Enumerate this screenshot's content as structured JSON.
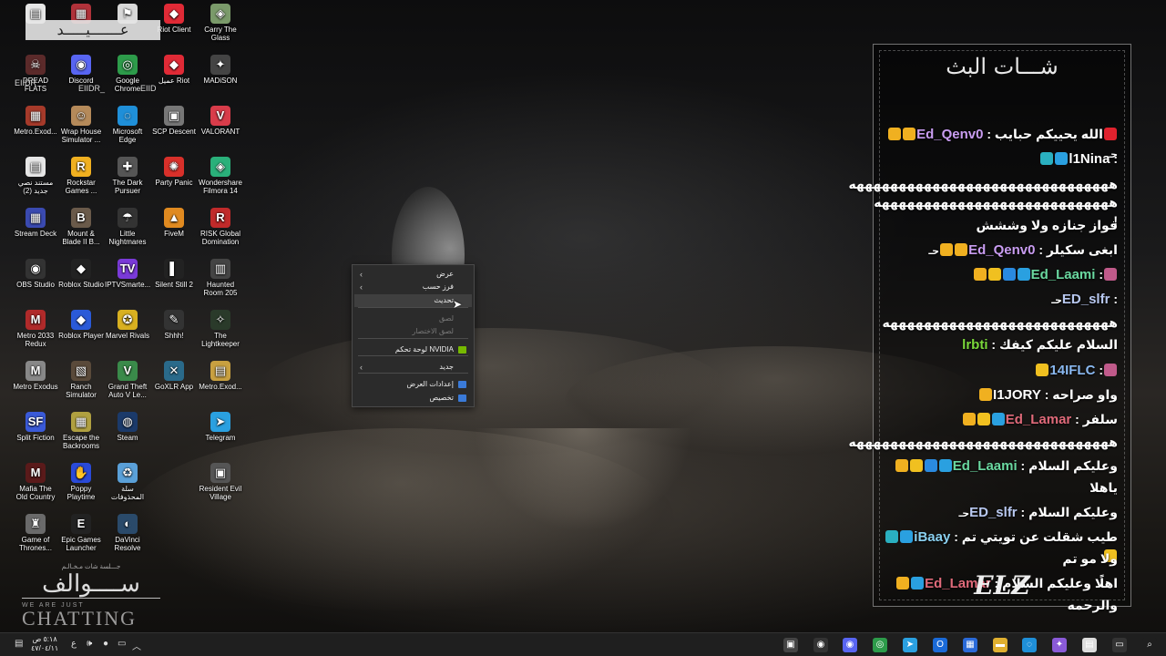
{
  "desktop": {
    "icons": [
      {
        "label": "",
        "glyph": "▤",
        "color": "#e6e6e6"
      },
      {
        "label": "",
        "glyph": "▦",
        "color": "#b0323a"
      },
      {
        "label": "",
        "glyph": "⚑",
        "color": "#d8d8d8"
      },
      {
        "label": "Riot Client",
        "glyph": "◆",
        "color": "#e02a36"
      },
      {
        "label": "Carry The Glass",
        "glyph": "◈",
        "color": "#7a9a6a"
      },
      {
        "label": "DREAD FLATS",
        "glyph": "☠",
        "color": "#5b2a2a"
      },
      {
        "label": "Discord",
        "glyph": "◉",
        "color": "#5865f2"
      },
      {
        "label": "Google Chrome",
        "glyph": "◎",
        "color": "#2d9b4a"
      },
      {
        "label": "عميل Riot",
        "glyph": "◆",
        "color": "#e02a36"
      },
      {
        "label": "MADiSON",
        "glyph": "✦",
        "color": "#444"
      },
      {
        "label": "Metro.Exod...",
        "glyph": "▦",
        "color": "#a63a2a"
      },
      {
        "label": "Wrap House Simulator ...",
        "glyph": "☺",
        "color": "#b58a5a"
      },
      {
        "label": "Microsoft Edge",
        "glyph": "◌",
        "color": "#1f8fd8"
      },
      {
        "label": "SCP Descent",
        "glyph": "▣",
        "color": "#777"
      },
      {
        "label": "VALORANT",
        "glyph": "V",
        "color": "#d83c4a"
      },
      {
        "label": "مستند نصي جديد (2)",
        "glyph": "▤",
        "color": "#e6e6e6"
      },
      {
        "label": "Rockstar Games ...",
        "glyph": "R",
        "color": "#f0b020"
      },
      {
        "label": "The Dark Pursuer",
        "glyph": "✚",
        "color": "#555"
      },
      {
        "label": "Party Panic",
        "glyph": "✺",
        "color": "#d8302a"
      },
      {
        "label": "Wondershare Filmora 14",
        "glyph": "◈",
        "color": "#2ab07a"
      },
      {
        "label": "Stream Deck",
        "glyph": "▦",
        "color": "#3a4ab0"
      },
      {
        "label": "Mount & Blade II B...",
        "glyph": "B",
        "color": "#6a5a4a"
      },
      {
        "label": "Little Nightmares",
        "glyph": "☂",
        "color": "#333"
      },
      {
        "label": "FiveM",
        "glyph": "▲",
        "color": "#e08a20"
      },
      {
        "label": "RISK Global Domination",
        "glyph": "R",
        "color": "#c02a2a"
      },
      {
        "label": "OBS Studio",
        "glyph": "◉",
        "color": "#333"
      },
      {
        "label": "Roblox Studio",
        "glyph": "◆",
        "color": "#222"
      },
      {
        "label": "IPTVSmarte...",
        "glyph": "TV",
        "color": "#7a3ad8"
      },
      {
        "label": "Silent Still 2",
        "glyph": "▌",
        "color": "#222"
      },
      {
        "label": "Haunted Room 205",
        "glyph": "▥",
        "color": "#444"
      },
      {
        "label": "Metro 2033 Redux",
        "glyph": "M",
        "color": "#b02a2a"
      },
      {
        "label": "Roblox Player",
        "glyph": "◆",
        "color": "#2a5ad8"
      },
      {
        "label": "Marvel Rivals",
        "glyph": "✪",
        "color": "#d8b020"
      },
      {
        "label": "Shhh!",
        "glyph": "✎",
        "color": "#333"
      },
      {
        "label": "The Lightkeeper",
        "glyph": "✧",
        "color": "#2a3a2a"
      },
      {
        "label": "Metro Exodus",
        "glyph": "M",
        "color": "#888"
      },
      {
        "label": "Ranch Simulator",
        "glyph": "▧",
        "color": "#5a4a3a"
      },
      {
        "label": "Grand Theft Auto V Le...",
        "glyph": "V",
        "color": "#3a8a4a"
      },
      {
        "label": "GoXLR App",
        "glyph": "✕",
        "color": "#2a6a8a"
      },
      {
        "label": "Metro.Exod...",
        "glyph": "▤",
        "color": "#c8a040"
      },
      {
        "label": "Split Fiction",
        "glyph": "SF",
        "color": "#3a5ad8"
      },
      {
        "label": "Escape the Backrooms",
        "glyph": "▦",
        "color": "#b0a040"
      },
      {
        "label": "Steam",
        "glyph": "◍",
        "color": "#1b3a6a"
      },
      {
        "label": "",
        "glyph": "",
        "color": "transparent"
      },
      {
        "label": "Telegram",
        "glyph": "➤",
        "color": "#2aa0e0"
      },
      {
        "label": "Mafia The Old Country",
        "glyph": "M",
        "color": "#5a1a1a"
      },
      {
        "label": "Poppy Playtime",
        "glyph": "✋",
        "color": "#2a4ad8"
      },
      {
        "label": "سلة المحذوفات",
        "glyph": "♻",
        "color": "#5aa0d8"
      },
      {
        "label": "",
        "glyph": "",
        "color": "transparent"
      },
      {
        "label": "Resident Evil Village",
        "glyph": "▣",
        "color": "#555"
      },
      {
        "label": "Game of Thrones...",
        "glyph": "♜",
        "color": "#6a6a6a"
      },
      {
        "label": "Epic Games Launcher",
        "glyph": "E",
        "color": "#222"
      },
      {
        "label": "DaVinci Resolve",
        "glyph": "◐",
        "color": "#2a4a6a"
      }
    ],
    "name_overlay": "عـــــــيـــــد",
    "discord_overlay": [
      "EIIDR",
      "EIIDR_",
      "EIID"
    ],
    "brand": {
      "sub": "جـــلسة شات مـخـالـم",
      "arabic": "ســــوالف",
      "small": "WE ARE JUST",
      "big": "CHATTING"
    }
  },
  "context_menu": {
    "items": [
      {
        "label": "عرض",
        "arrow": true,
        "state": "normal"
      },
      {
        "label": "فرز حسب",
        "arrow": true,
        "state": "normal"
      },
      {
        "label": "تحديث",
        "arrow": false,
        "state": "hover"
      },
      {
        "label": "لصق",
        "arrow": false,
        "state": "disabled"
      },
      {
        "label": "لصق الاختصار",
        "arrow": false,
        "state": "disabled"
      },
      {
        "label": "لوحة تحكم NVIDIA",
        "arrow": false,
        "state": "normal",
        "icon_color": "#76b900"
      },
      {
        "label": "جديد",
        "arrow": true,
        "state": "normal"
      },
      {
        "label": "إعدادات العرض",
        "arrow": false,
        "state": "normal",
        "icon_color": "#3a7ad8"
      },
      {
        "label": "تخصيص",
        "arrow": false,
        "state": "normal",
        "icon_color": "#3a7ad8"
      }
    ]
  },
  "chat": {
    "title": "شـــات البث",
    "logo": "ELZ",
    "messages": [
      {
        "badges": [
          "#e0222e"
        ],
        "text": "الله يحييكم حبايب : ",
        "user": "Ed_Qenv0",
        "user_color": "#c89cf0",
        "extra_badges": [
          "#f0b020",
          "#f0b020"
        ],
        "tail": "حـ"
      },
      {
        "badges": [],
        "text": ": ",
        "user": "l1Nina",
        "user_color": "#ffffff",
        "extra_badges": [
          "#2aa0e0",
          "#2ab0c0"
        ],
        "tail": ""
      },
      {
        "badges": [],
        "text": "هههههههههههههههههههههههههههههههه",
        "user": "",
        "user_color": "#fff",
        "extra_badges": [],
        "tail": ""
      },
      {
        "badges": [],
        "text": "ههههههههههههههههههههههههههههه !",
        "user": "",
        "user_color": "#fff",
        "extra_badges": [],
        "tail": ""
      },
      {
        "badges": [],
        "text": "فواز جنازه ولا وششش",
        "user": "",
        "user_color": "#fff",
        "extra_badges": [],
        "tail": ""
      },
      {
        "badges": [],
        "text": "ابغى سكيلر : ",
        "user": "Ed_Qenv0",
        "user_color": "#c89cf0",
        "extra_badges": [
          "#f0b020",
          "#f0b020"
        ],
        "tail": "حـ"
      },
      {
        "badges": [
          "#c05a8a"
        ],
        "text": ": ",
        "user": "Ed_Laami",
        "user_color": "#6ad8a0",
        "extra_badges": [
          "#2aa0e0",
          "#2a8ae0",
          "#f0c020",
          "#f0b020"
        ],
        "tail": ""
      },
      {
        "badges": [],
        "text": ": ",
        "user": "ED_slfr",
        "user_color": "#b8c8f0",
        "extra_badges": [],
        "tail": "حـ"
      },
      {
        "badges": [],
        "text": "هههههههههههههههههههههههههههه",
        "user": "",
        "user_color": "#fff",
        "extra_badges": [],
        "tail": ""
      },
      {
        "badges": [],
        "text": "السلام عليكم كيفك : ",
        "user": "lrbti",
        "user_color": "#7ad83a",
        "extra_badges": [],
        "tail": ""
      },
      {
        "badges": [
          "#c05a8a"
        ],
        "text": ": ",
        "user": "14IFLC",
        "user_color": "#8ab8f0",
        "extra_badges": [
          "#f0c020"
        ],
        "tail": ""
      },
      {
        "badges": [],
        "text": "واو صراحه : ",
        "user": "I1JORY",
        "user_color": "#ffffff",
        "extra_badges": [
          "#f0b020"
        ],
        "tail": ""
      },
      {
        "badges": [],
        "text": "سلفر : ",
        "user": "Ed_Lamar",
        "user_color": "#e06a7a",
        "extra_badges": [
          "#2aa0e0",
          "#f0c020",
          "#f0b020"
        ],
        "tail": ""
      },
      {
        "badges": [],
        "text": "هههههههههههههههههههههههههههههههه",
        "user": "",
        "user_color": "#fff",
        "extra_badges": [],
        "tail": ""
      },
      {
        "badges": [],
        "text": "وعليكم السلام : ",
        "user": "Ed_Laami",
        "user_color": "#6ad8a0",
        "extra_badges": [
          "#2aa0e0",
          "#2a8ae0",
          "#f0c020",
          "#f0b020"
        ],
        "tail": ""
      },
      {
        "badges": [],
        "text": "ياهلا",
        "user": "",
        "user_color": "#fff",
        "extra_badges": [],
        "tail": ""
      },
      {
        "badges": [],
        "text": "وعليكم السلام : ",
        "user": "ED_slfr",
        "user_color": "#b8c8f0",
        "extra_badges": [],
        "tail": "حـ"
      },
      {
        "badges": [],
        "text": "طيب شقلت عن تويتي تم : ",
        "user": "iBaay",
        "user_color": "#8ad0f0",
        "extra_badges": [
          "#2aa0e0",
          "#2ab0c0",
          "#f0c020"
        ],
        "tail": ""
      },
      {
        "badges": [],
        "text": "ولا مو تم",
        "user": "",
        "user_color": "#fff",
        "extra_badges": [],
        "tail": ""
      },
      {
        "badges": [],
        "text": "اهلًا وعليكم السلام : ",
        "user": "Ed_Lamar",
        "user_color": "#e06a7a",
        "extra_badges": [
          "#2aa0e0",
          "#f0b020"
        ],
        "tail": ""
      },
      {
        "badges": [],
        "text": "والرحمه",
        "user": "",
        "user_color": "#fff",
        "extra_badges": [],
        "tail": ""
      }
    ]
  },
  "taskbar": {
    "clock_time": "٥:١٨ ص",
    "clock_date": "٤٧/٠٤/١١",
    "lang": "ع",
    "icons": [
      {
        "name": "widgets-icon",
        "glyph": "▣",
        "color": "#444"
      },
      {
        "name": "obs-taskbar-icon",
        "glyph": "◉",
        "color": "#333"
      },
      {
        "name": "discord-taskbar-icon",
        "glyph": "◉",
        "color": "#5865f2"
      },
      {
        "name": "chrome-taskbar-icon",
        "glyph": "◎",
        "color": "#2d9b4a"
      },
      {
        "name": "telegram-taskbar-icon",
        "glyph": "➤",
        "color": "#2aa0e0"
      },
      {
        "name": "outlook-taskbar-icon",
        "glyph": "O",
        "color": "#1a6ad8"
      },
      {
        "name": "store-taskbar-icon",
        "glyph": "▦",
        "color": "#2a6ad8"
      },
      {
        "name": "explorer-taskbar-icon",
        "glyph": "▬",
        "color": "#e0b030"
      },
      {
        "name": "edge-taskbar-icon",
        "glyph": "◌",
        "color": "#1f8fd8"
      },
      {
        "name": "copilot-taskbar-icon",
        "glyph": "✦",
        "color": "#8a5ad8"
      },
      {
        "name": "file-taskbar-icon",
        "glyph": "▤",
        "color": "#ddd"
      },
      {
        "name": "task-view-icon",
        "glyph": "▭",
        "color": "#333"
      },
      {
        "name": "search-taskbar-icon",
        "glyph": "⌕",
        "color": "#1f1f1f"
      },
      {
        "name": "start-menu-icon",
        "glyph": "⊞",
        "color": "#1f1f1f"
      }
    ]
  }
}
